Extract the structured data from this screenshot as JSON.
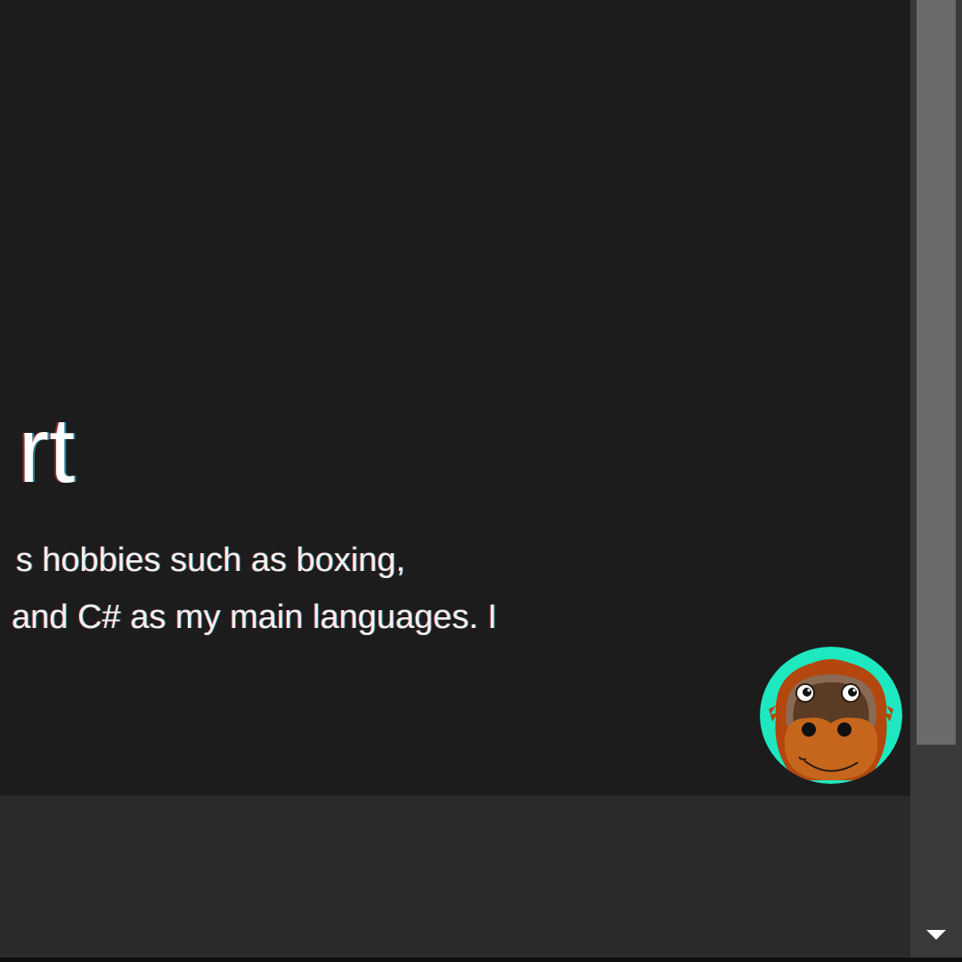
{
  "hero": {
    "heading_fragment": "rt",
    "paragraph_lines": [
      "s hobbies such as boxing,",
      "and C# as my main languages. I"
    ]
  },
  "avatar": {
    "icon": "orangutan-face-icon",
    "ring_color": "#1ee8c0"
  },
  "scrollbar": {
    "down_arrow_icon": "triangle-down-icon"
  },
  "colors": {
    "page_background": "#1d1c1d",
    "footer_background": "#2a2a2a",
    "scroll_track": "#3a3a3a",
    "scroll_thumb": "#6b6b6b",
    "text": "#ffffff"
  }
}
